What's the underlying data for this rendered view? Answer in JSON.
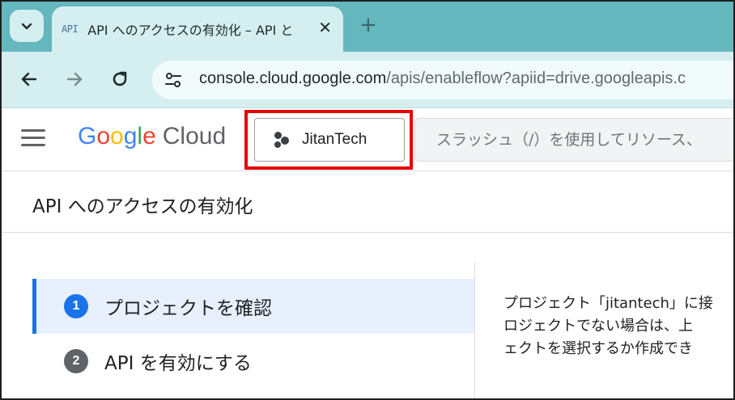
{
  "browser": {
    "tab": {
      "favicon_text": "API",
      "title": "API へのアクセスの有効化 – API と",
      "close_glyph": "✕"
    },
    "new_tab_glyph": "+",
    "url": {
      "host": "console.cloud.google.com",
      "path": "/apis/enableflow?apiid=drive.googleapis.c"
    }
  },
  "console": {
    "brand": {
      "g1": "G",
      "g2": "o",
      "g3": "o",
      "g4": "g",
      "g5": "l",
      "g6": "e",
      "cloud": "Cloud"
    },
    "project_name": "JitanTech",
    "search_placeholder": "スラッシュ（/）を使用してリソース、"
  },
  "page": {
    "title": "API へのアクセスの有効化",
    "steps": [
      {
        "number": "1",
        "label": "プロジェクトを確認",
        "active": true,
        "color": "#1a73e8"
      },
      {
        "number": "2",
        "label": "API を有効にする",
        "active": false,
        "color": "#5f6368"
      }
    ],
    "description_lines": [
      "プロジェクト「jitantech」に接",
      "ロジェクトでない場合は、上",
      "ェクトを選択するか作成でき"
    ]
  },
  "colors": {
    "tabstrip": "#63b7bd",
    "toolbar": "#d5eef0",
    "highlight": "#e60000",
    "accent": "#1a73e8"
  }
}
